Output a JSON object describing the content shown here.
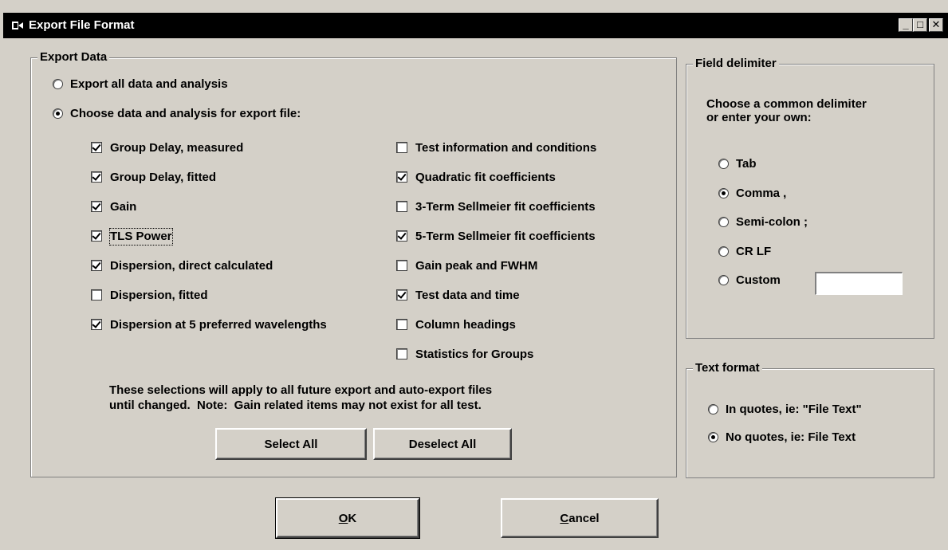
{
  "window": {
    "title": "Export File Format",
    "controls": {
      "minimize": "_",
      "maximize": "□",
      "close": "✕"
    }
  },
  "export_data": {
    "legend": "Export Data",
    "radio_all": {
      "label": "Export all data and analysis",
      "selected": false
    },
    "radio_choose": {
      "label": "Choose data and analysis for export file:",
      "selected": true
    },
    "left_items": [
      {
        "label": "Group Delay, measured",
        "checked": true
      },
      {
        "label": "Group Delay, fitted",
        "checked": true
      },
      {
        "label": "Gain",
        "checked": true
      },
      {
        "label": "TLS Power",
        "checked": true
      },
      {
        "label": "Dispersion, direct calculated",
        "checked": true
      },
      {
        "label": "Dispersion, fitted",
        "checked": false
      },
      {
        "label": "Dispersion at 5 preferred wavelengths",
        "checked": true
      }
    ],
    "right_items": [
      {
        "label": "Test information and conditions",
        "checked": false
      },
      {
        "label": "Quadratic fit coefficients",
        "checked": true
      },
      {
        "label": "3-Term Sellmeier fit coefficients",
        "checked": false
      },
      {
        "label": "5-Term Sellmeier fit coefficients",
        "checked": true
      },
      {
        "label": "Gain peak and FWHM",
        "checked": false
      },
      {
        "label": "Test data and time",
        "checked": true
      },
      {
        "label": "Column headings",
        "checked": false
      },
      {
        "label": "Statistics for Groups",
        "checked": false
      }
    ],
    "note_line1": "These selections will apply to all future export and auto-export files",
    "note_line2": "until changed.  Note:  Gain related items may not exist for all test.",
    "select_all_label": "Select All",
    "deselect_all_label": "Deselect All"
  },
  "field_delimiter": {
    "legend": "Field delimiter",
    "prompt_line1": "Choose a common delimiter",
    "prompt_line2": "or enter your own:",
    "options": [
      {
        "label": "Tab",
        "selected": false
      },
      {
        "label": "Comma ,",
        "selected": true
      },
      {
        "label": "Semi-colon ;",
        "selected": false
      },
      {
        "label": "CR LF",
        "selected": false
      },
      {
        "label": "Custom",
        "selected": false
      }
    ],
    "custom_value": ""
  },
  "text_format": {
    "legend": "Text format",
    "options": [
      {
        "label": "In quotes, ie: \"File Text\"",
        "selected": false
      },
      {
        "label": "No quotes, ie: File Text",
        "selected": true
      }
    ]
  },
  "buttons": {
    "ok_mnemonic": "O",
    "ok_rest": "K",
    "cancel_mnemonic": "C",
    "cancel_rest": "ancel"
  }
}
